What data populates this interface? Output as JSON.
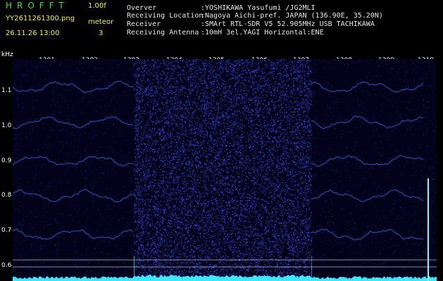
{
  "header": {
    "brand": "HROFFT",
    "version": "1.00f",
    "filename": "YY2611261300.png",
    "meteor_label": "meteor",
    "datetime": "26.11.26 13:00",
    "meteor_count": "3"
  },
  "info": [
    {
      "label": "Overver",
      "value": ":YOSHIKAWA Yasufumi /JG2MLI"
    },
    {
      "label": "Receiving Location",
      "value": ":Nagoya Aichi-pref. JAPAN (136.90E, 35.20N)"
    },
    {
      "label": "Receiver",
      "value": ":SMArt RTL-SDR V5 52.905MHz USB TACHIKAWA"
    },
    {
      "label": "Receiving Antenna",
      "value": ":10mH 3el.YAGI Horizontal:ENE"
    }
  ],
  "axis": {
    "y_unit": "kHz",
    "x_ticks": [
      "1301",
      "1302",
      "1303",
      "1304",
      "1305",
      "1306",
      "1307",
      "1308",
      "1309",
      "1310"
    ],
    "y_ticks": [
      "1.1",
      "1.0",
      "0.9",
      "0.8",
      "0.7",
      "0.6"
    ]
  },
  "colors": {
    "background": "#000000",
    "green_text": "#3ee03e",
    "yellow_text": "#f2f233",
    "noise": "#3a56ff",
    "trace": "#5070ff",
    "baseline": "#3fe6ff"
  }
}
